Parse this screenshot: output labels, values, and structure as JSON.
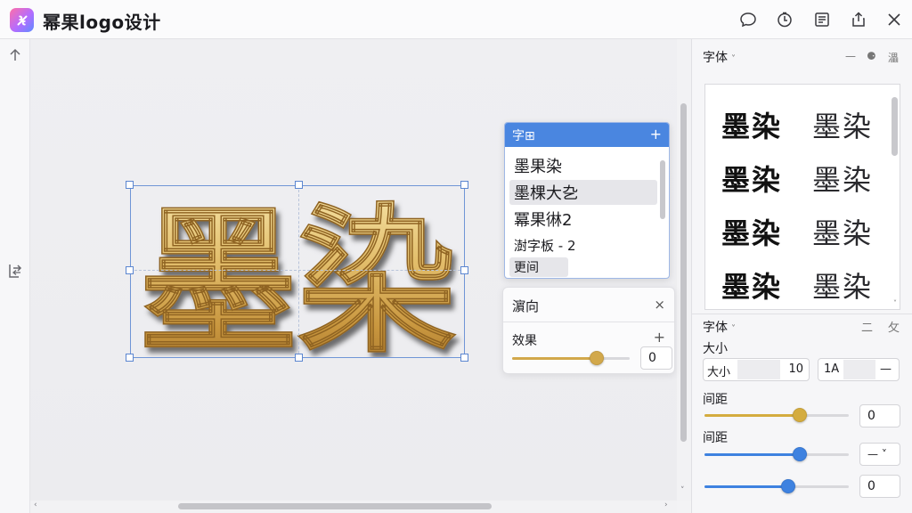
{
  "app": {
    "title": "幂果logo设计",
    "accent": "#4a86e0",
    "gold": "#d2a84b"
  },
  "toolbar_icons": [
    "chat-icon",
    "timer-icon",
    "layout-icon",
    "share-icon",
    "close-icon"
  ],
  "left_toolbar_icons": [
    "arrow-up-icon",
    "swap-icon"
  ],
  "artwork": {
    "text": "墨染"
  },
  "font_popup": {
    "title": "字⊞",
    "add": "+",
    "items": [
      {
        "label": "墨果染"
      },
      {
        "label": "墨棵大㐇"
      },
      {
        "label": "冪果㣩2"
      },
      {
        "label": "澍字板 - 2"
      },
      {
        "label": "更间"
      }
    ]
  },
  "effect_panel": {
    "title": "濵向",
    "close": "×",
    "label": "效果",
    "add": "+",
    "slider_value": 0.72,
    "value": "0"
  },
  "right_panel": {
    "section_title": "字体",
    "mini_icons": [
      "—",
      "⚈",
      "㵽"
    ],
    "preview_glyphs": [
      "墨染",
      "墨染",
      "墨染",
      "墨染",
      "墨染",
      "墨染",
      "墨染",
      "墨染"
    ],
    "font_label": "字体",
    "font_icons": [
      "⼆",
      "⺙"
    ],
    "size_title": "大小",
    "size_box_label": "大小",
    "size_value": "10",
    "alt_box_label": "1A",
    "alt_box_action": "—",
    "spacing_title_1": "间距",
    "spacing_slider_1": 0.66,
    "spacing_value_1": "0",
    "spacing_title_2": "间距",
    "spacing_slider_2": 0.66,
    "spacing_dropdown": "— ˅",
    "slider_3": 0.58,
    "value_3": "0",
    "slider_colors": [
      "#d4ac3f",
      "#3e82e0",
      "#3e82e0"
    ]
  }
}
